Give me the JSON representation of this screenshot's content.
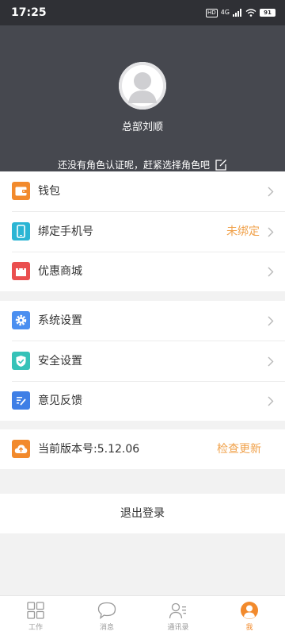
{
  "status_bar": {
    "time": "17:25",
    "hd": "HD",
    "network": "4G",
    "battery": "91"
  },
  "profile": {
    "name": "总部刘顺",
    "role_tip": "还没有角色认证呢，赶紧选择角色吧"
  },
  "menu": {
    "wallet": "钱包",
    "bind_phone": "绑定手机号",
    "bind_phone_status": "未绑定",
    "mall": "优惠商城",
    "system_settings": "系统设置",
    "security_settings": "安全设置",
    "feedback": "意见反馈",
    "version": "当前版本号:5.12.06",
    "check_update": "检查更新"
  },
  "logout": "退出登录",
  "tabs": [
    {
      "label": "工作",
      "icon": "grid-icon"
    },
    {
      "label": "消息",
      "icon": "chat-bubble-icon"
    },
    {
      "label": "通讯录",
      "icon": "contacts-icon"
    },
    {
      "label": "我",
      "icon": "person-icon",
      "active": true
    }
  ],
  "colors": {
    "accent": "#f28a2c",
    "header_bg": "#46484f",
    "status_bg": "#2f3035"
  }
}
